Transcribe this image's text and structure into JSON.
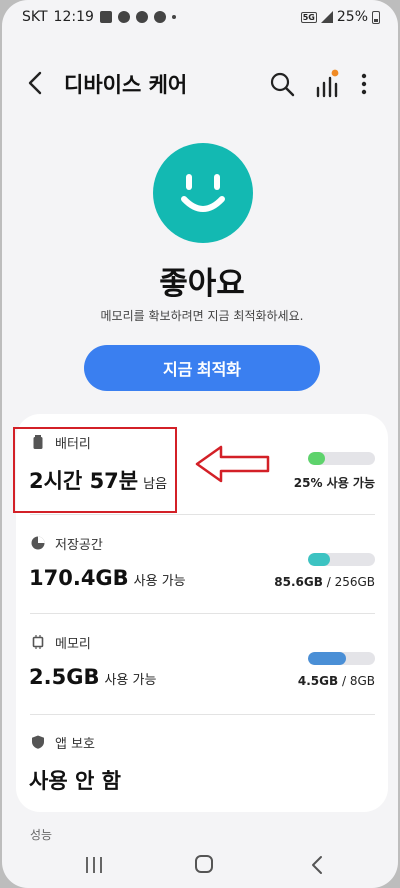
{
  "statusbar": {
    "carrier": "SKT",
    "time": "12:19",
    "network": "5G",
    "battery": "25%"
  },
  "header": {
    "title": "디바이스 케어"
  },
  "device_status": {
    "status": "좋아요",
    "message": "메모리를 확보하려면 지금 최적화하세요.",
    "optimize_button": "지금 최적화"
  },
  "items": [
    {
      "label": "배터리",
      "value": "2시간 57분",
      "unit": "남음",
      "caption_bold": "25% 사용 가능",
      "caption_rest": "",
      "bar_fraction": 0.25,
      "bar_color": "#5ed36c",
      "icon": "battery-icon"
    },
    {
      "label": "저장공간",
      "value": "170.4GB",
      "unit": "사용 가능",
      "caption_bold": "85.6GB",
      "caption_rest": " / 256GB",
      "bar_fraction": 0.334,
      "bar_color": "#3cc3c2",
      "icon": "storage-pie-icon"
    },
    {
      "label": "메모리",
      "value": "2.5GB",
      "unit": "사용 가능",
      "caption_bold": "4.5GB",
      "caption_rest": " / 8GB",
      "bar_fraction": 0.5625,
      "bar_color": "#4a8fd6",
      "icon": "memory-chip-icon"
    },
    {
      "label": "앱 보호",
      "value": "사용 안 함",
      "unit": "",
      "icon": "shield-icon"
    }
  ],
  "peek_label": "성능",
  "colors": {
    "accent": "#3a7ff0",
    "face": "#13b9b2",
    "annotation": "#d32027",
    "notification_dot": "#f08a24"
  }
}
